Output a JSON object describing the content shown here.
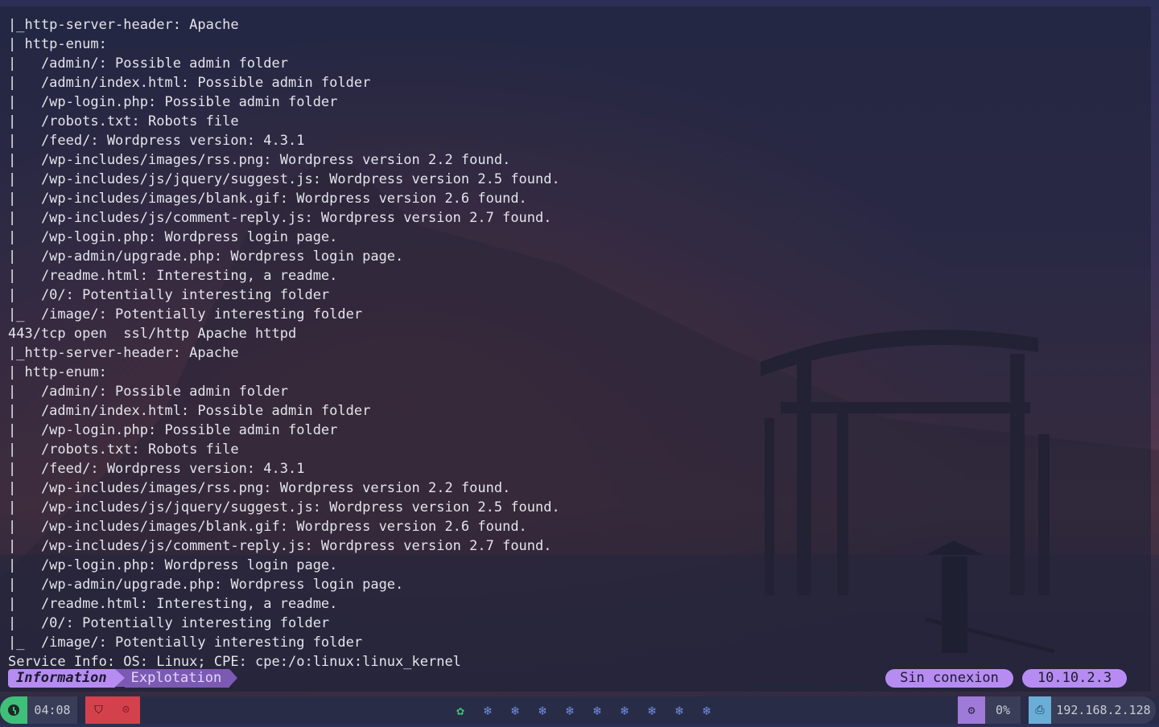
{
  "terminal": {
    "lines": [
      "|_http-server-header: Apache",
      "| http-enum:",
      "|   /admin/: Possible admin folder",
      "|   /admin/index.html: Possible admin folder",
      "|   /wp-login.php: Possible admin folder",
      "|   /robots.txt: Robots file",
      "|   /feed/: Wordpress version: 4.3.1",
      "|   /wp-includes/images/rss.png: Wordpress version 2.2 found.",
      "|   /wp-includes/js/jquery/suggest.js: Wordpress version 2.5 found.",
      "|   /wp-includes/images/blank.gif: Wordpress version 2.6 found.",
      "|   /wp-includes/js/comment-reply.js: Wordpress version 2.7 found.",
      "|   /wp-login.php: Wordpress login page.",
      "|   /wp-admin/upgrade.php: Wordpress login page.",
      "|   /readme.html: Interesting, a readme.",
      "|   /0/: Potentially interesting folder",
      "|_  /image/: Potentially interesting folder",
      "443/tcp open  ssl/http Apache httpd",
      "|_http-server-header: Apache",
      "| http-enum:",
      "|   /admin/: Possible admin folder",
      "|   /admin/index.html: Possible admin folder",
      "|   /wp-login.php: Possible admin folder",
      "|   /robots.txt: Robots file",
      "|   /feed/: Wordpress version: 4.3.1",
      "|   /wp-includes/images/rss.png: Wordpress version 2.2 found.",
      "|   /wp-includes/js/jquery/suggest.js: Wordpress version 2.5 found.",
      "|   /wp-includes/images/blank.gif: Wordpress version 2.6 found.",
      "|   /wp-includes/js/comment-reply.js: Wordpress version 2.7 found.",
      "|   /wp-login.php: Wordpress login page.",
      "|   /wp-admin/upgrade.php: Wordpress login page.",
      "|   /readme.html: Interesting, a readme.",
      "|   /0/: Potentially interesting folder",
      "|_  /image/: Potentially interesting folder",
      "Service Info: OS: Linux; CPE: cpe:/o:linux:linux_kernel"
    ]
  },
  "tmux": {
    "windows": [
      "Information",
      "Explotation"
    ],
    "status_connection": "Sin conexion",
    "status_ip": "10.10.2.3"
  },
  "bar": {
    "clock_icon": "clock-icon",
    "time": "04:08",
    "red_icon_1": "shield-icon",
    "red_icon_1_glyph": "⛉",
    "red_icon_2": "ghost-icon",
    "red_icon_2_glyph": "☹",
    "workspaces": [
      "✿",
      "❄",
      "❄",
      "❄",
      "❄",
      "❄",
      "❄",
      "❄",
      "❄",
      "❄"
    ],
    "active_workspace": 0,
    "cpu_icon_glyph": "⚙",
    "cpu": "0%",
    "net_icon_glyph": "⎙",
    "ip": "192.168.2.128"
  },
  "colors": {
    "accent": "#b78cf2",
    "green": "#3fbf7a",
    "red": "#d3414d",
    "blue": "#6f8fe8"
  }
}
